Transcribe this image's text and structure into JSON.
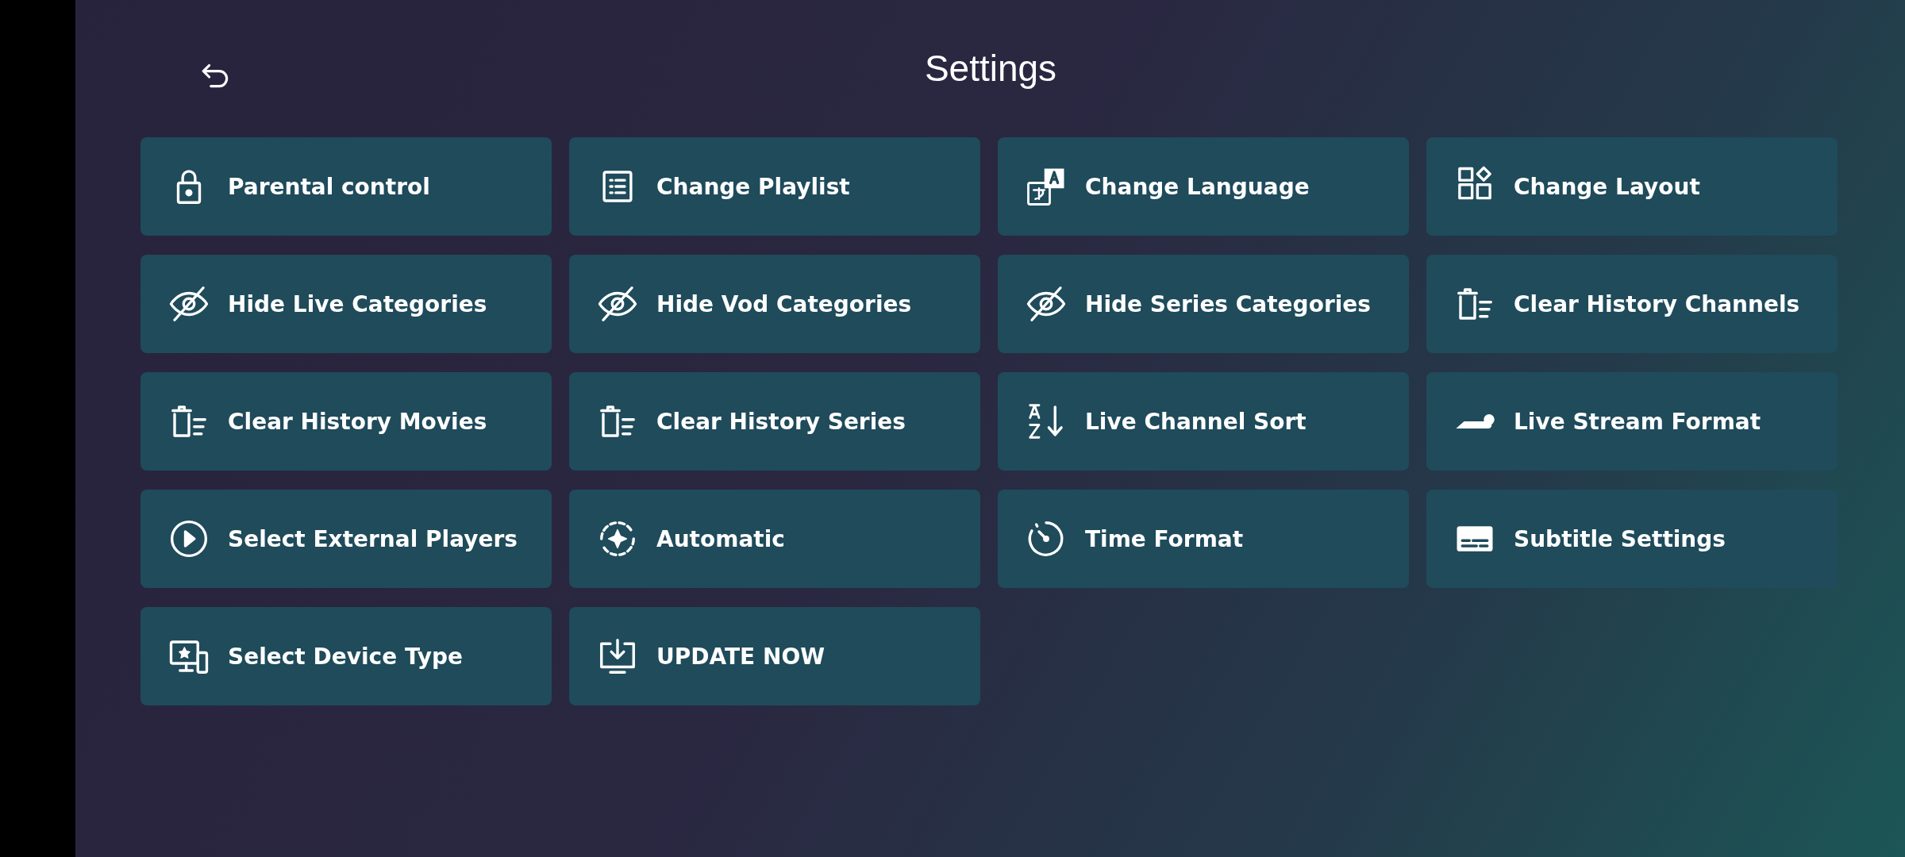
{
  "header": {
    "title": "Settings"
  },
  "items": [
    {
      "kind": "lock",
      "label": "Parental control"
    },
    {
      "kind": "list",
      "label": "Change Playlist"
    },
    {
      "kind": "language",
      "label": "Change Language"
    },
    {
      "kind": "layout",
      "label": "Change Layout"
    },
    {
      "kind": "hide",
      "label": "Hide Live Categories"
    },
    {
      "kind": "hide",
      "label": "Hide Vod Categories"
    },
    {
      "kind": "hide",
      "label": "Hide Series Categories"
    },
    {
      "kind": "clear",
      "label": "Clear History Channels"
    },
    {
      "kind": "clear",
      "label": "Clear History Movies"
    },
    {
      "kind": "clear",
      "label": "Clear History Series"
    },
    {
      "kind": "sort",
      "label": "Live Channel Sort"
    },
    {
      "kind": "stream",
      "label": "Live Stream Format"
    },
    {
      "kind": "play",
      "label": "Select External Players"
    },
    {
      "kind": "auto",
      "label": "Automatic"
    },
    {
      "kind": "timer",
      "label": "Time Format"
    },
    {
      "kind": "subtitle",
      "label": "Subtitle Settings"
    },
    {
      "kind": "device",
      "label": "Select Device Type"
    },
    {
      "kind": "update",
      "label": "UPDATE NOW"
    }
  ]
}
